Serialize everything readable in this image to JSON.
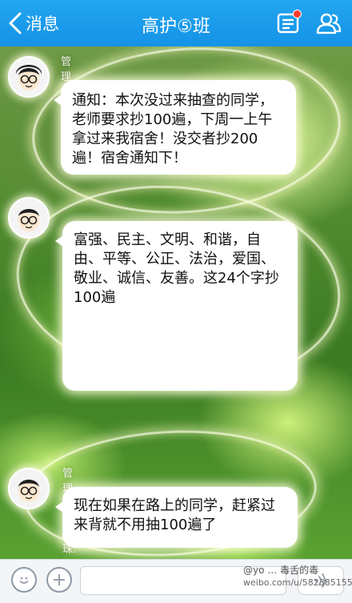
{
  "header": {
    "back_label": "消息",
    "title": "高护⑤班"
  },
  "colors": {
    "header": "#1a9aea",
    "bubble": "#ffffff",
    "notification_dot": "#ff3b30"
  },
  "messages": [
    {
      "sender": "管理员",
      "text": "通知：本次没过来抽查的同学，老师要求抄100遍，下周一上午拿过来我宿舍！没交者抄200遍！宿舍通知下！"
    },
    {
      "sender": "",
      "text": "富强、民主、文明、和谐，自由、平等、公正、法治，爱国、敬业、诚信、友善。这24个字抄100遍"
    },
    {
      "sender": "管理员  李晓珠:",
      "text": "现在如果在路上的同学，赶紧过来背就不用抽100遍了"
    }
  ],
  "input": {
    "placeholder": ""
  },
  "watermark": {
    "line1": "@yo  …  毒舌的毒",
    "line2": "weibo.com/u/5823851550"
  },
  "icons": [
    "back-chevron-icon",
    "notice-icon",
    "people-icon",
    "emoji-icon",
    "plus-icon",
    "voice-icon"
  ]
}
